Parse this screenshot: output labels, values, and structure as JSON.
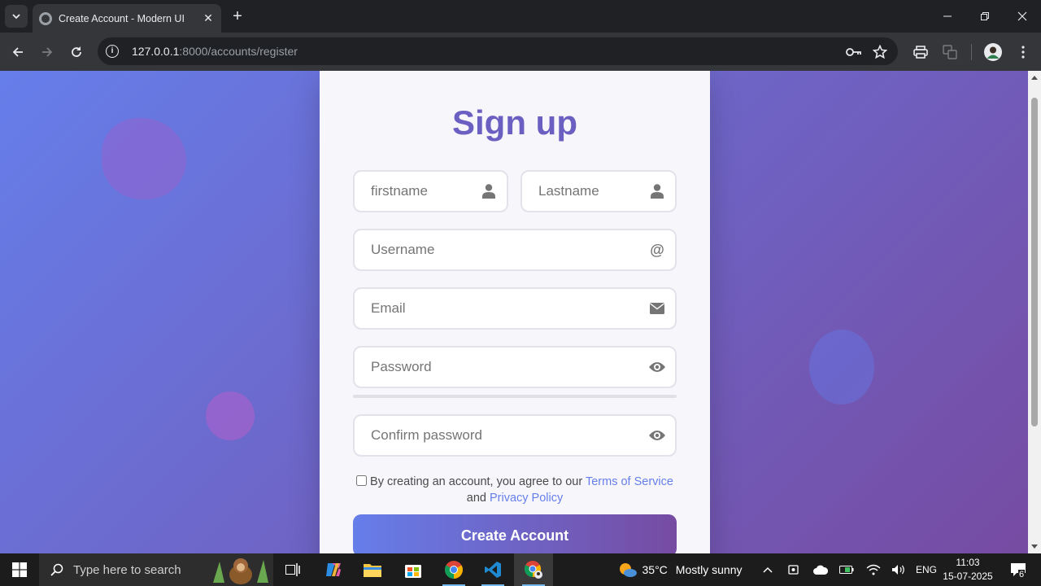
{
  "browser": {
    "tab_title": "Create Account - Modern UI",
    "url_host": "127.0.0.1",
    "url_rest": ":8000/accounts/register"
  },
  "form": {
    "title": "Sign up",
    "firstname_placeholder": "firstname",
    "lastname_placeholder": "Lastname",
    "username_placeholder": "Username",
    "email_placeholder": "Email",
    "password_placeholder": "Password",
    "confirm_placeholder": "Confirm password",
    "terms_prefix": "By creating an account, you agree to our",
    "terms_link": "Terms of Service",
    "terms_and": "and",
    "privacy_link": "Privacy Policy",
    "submit_label": "Create Account"
  },
  "taskbar": {
    "search_placeholder": "Type here to search",
    "weather_temp": "35°C",
    "weather_desc": "Mostly sunny",
    "language": "ENG",
    "time": "11:03",
    "date": "15-07-2025",
    "notifications": "6"
  },
  "colors": {
    "gradient_start": "#667eea",
    "gradient_end": "#764ba2",
    "title": "#6b5fc2",
    "link": "#667eea"
  }
}
